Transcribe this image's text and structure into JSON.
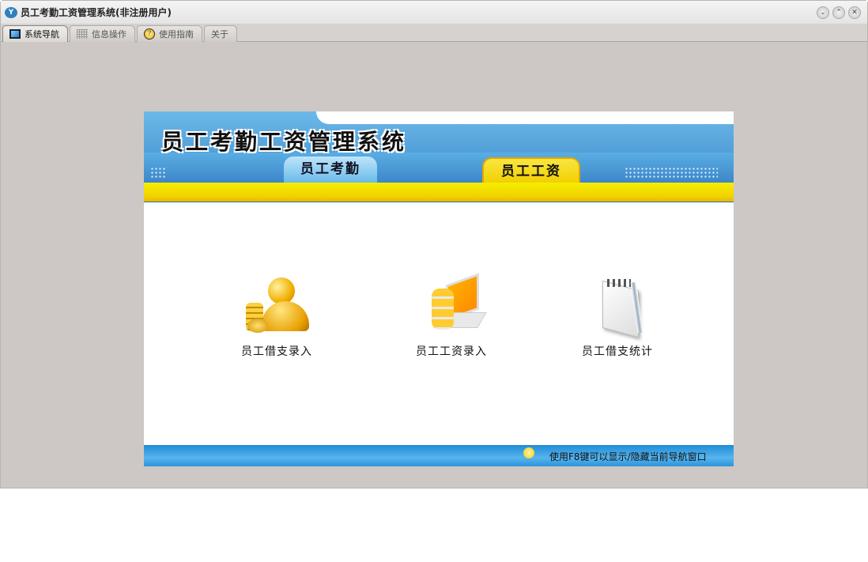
{
  "window": {
    "title": "员工考勤工资管理系统(非注册用户)",
    "controls": [
      "minimize",
      "maximize",
      "close"
    ]
  },
  "tabs": [
    {
      "label": "系统导航",
      "icon": "monitor-icon",
      "active": true
    },
    {
      "label": "信息操作",
      "icon": "grid-icon",
      "active": false
    },
    {
      "label": "使用指南",
      "icon": "help-icon",
      "active": false
    },
    {
      "label": "关于",
      "icon": "",
      "active": false
    }
  ],
  "banner": {
    "title": "员工考勤工资管理系统",
    "tabs": [
      {
        "label": "员工考勤",
        "active": false
      },
      {
        "label": "员工工资",
        "active": true
      }
    ],
    "colors": {
      "blue": "#4a98d4",
      "yellow": "#f6ee00"
    }
  },
  "items": [
    {
      "label": "员工借支录入",
      "icon": "user-coins-icon"
    },
    {
      "label": "员工工资录入",
      "icon": "laptop-coins-icon"
    },
    {
      "label": "员工借支统计",
      "icon": "notepad-pen-icon"
    }
  ],
  "footer": {
    "hint": "使用F8键可以显示/隐藏当前导航窗口",
    "icon": "lightbulb-icon"
  }
}
